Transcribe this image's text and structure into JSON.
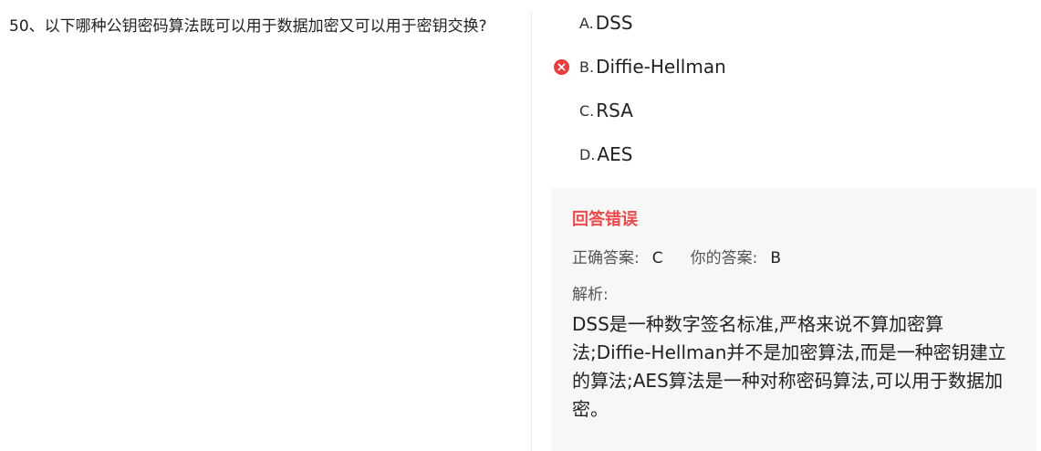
{
  "question": {
    "number": "50、",
    "text": "以下哪种公钥密码算法既可以用于数据加密又可以用于密钥交换?"
  },
  "options": [
    {
      "letter": "A.",
      "text": "DSS",
      "status": "none"
    },
    {
      "letter": "B.",
      "text": "Diffie-Hellman",
      "status": "wrong"
    },
    {
      "letter": "C.",
      "text": "RSA",
      "status": "none"
    },
    {
      "letter": "D.",
      "text": "AES",
      "status": "none"
    }
  ],
  "panel": {
    "result": "回答错误",
    "correct_label": "正确答案:",
    "correct_value": "C",
    "yours_label": "你的答案:",
    "yours_value": "B",
    "analysis_label": "解析:",
    "analysis_text": "DSS是一种数字签名标准,严格来说不算加密算法;Diffie-Hellman并不是加密算法,而是一种密钥建立的算法;AES算法是一种对称密码算法,可以用于数据加密。"
  },
  "colors": {
    "error": "#f04848",
    "wrong_icon": "#f13b3b",
    "panel_bg": "#f7f7f7"
  },
  "icons": {
    "wrong": "close-circle-icon"
  }
}
